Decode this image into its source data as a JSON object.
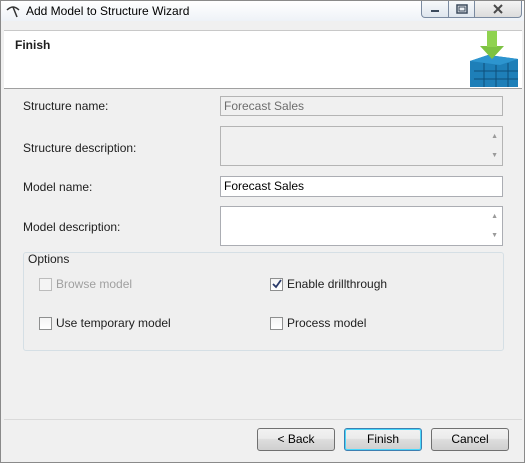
{
  "window": {
    "title": "Add Model to Structure Wizard",
    "icons": {
      "app": "pickaxe-icon",
      "minimize": "minimize-icon",
      "maximize": "maximize-icon",
      "close": "close-icon"
    }
  },
  "header": {
    "title": "Finish",
    "logo_icon": "mining-structure-arrow-icon"
  },
  "form": {
    "structure_name": {
      "label": "Structure name:",
      "value": "Forecast Sales"
    },
    "structure_description": {
      "label": "Structure description:",
      "value": ""
    },
    "model_name": {
      "label": "Model name:",
      "value": "Forecast Sales"
    },
    "model_description": {
      "label": "Model description:",
      "value": ""
    }
  },
  "options": {
    "title": "Options",
    "browse_model": {
      "label": "Browse model",
      "checked": false,
      "enabled": false
    },
    "enable_drillthrough": {
      "label": "Enable drillthrough",
      "checked": true,
      "enabled": true
    },
    "use_temporary_model": {
      "label": "Use temporary model",
      "checked": false,
      "enabled": true
    },
    "process_model": {
      "label": "Process model",
      "checked": false,
      "enabled": true
    }
  },
  "buttons": {
    "back": "< Back",
    "finish": "Finish",
    "cancel": "Cancel"
  },
  "colors": {
    "accent_green": "#7dc242",
    "cube_blue": "#1e7fb8",
    "default_button_border": "#3c7fb1"
  }
}
